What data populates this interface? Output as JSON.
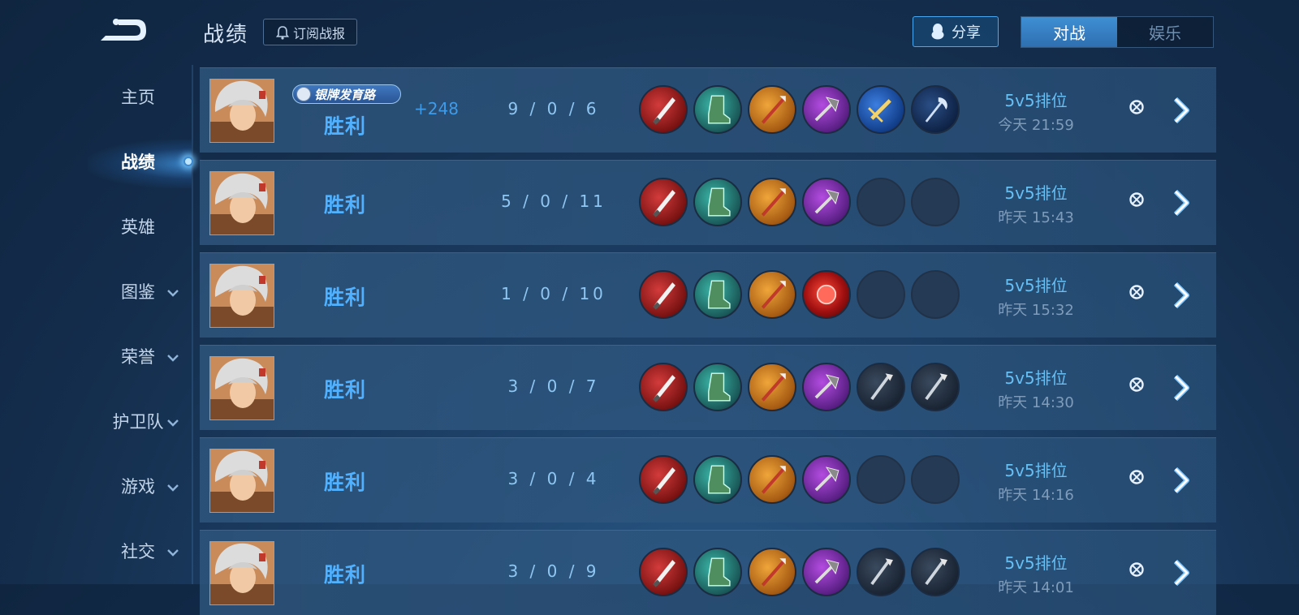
{
  "header": {
    "title": "战绩",
    "subscribe_label": "订阅战报",
    "share_label": "分享",
    "tabs": [
      {
        "label": "对战",
        "active": true
      },
      {
        "label": "娱乐",
        "active": false
      }
    ]
  },
  "sidebar": {
    "items": [
      {
        "label": "主页",
        "has_chevron": false,
        "active": false
      },
      {
        "label": "战绩",
        "has_chevron": false,
        "active": true
      },
      {
        "label": "英雄",
        "has_chevron": false,
        "active": false
      },
      {
        "label": "图鉴",
        "has_chevron": true,
        "active": false
      },
      {
        "label": "荣誉",
        "has_chevron": true,
        "active": false
      },
      {
        "label": "护卫队",
        "has_chevron": true,
        "active": false
      },
      {
        "label": "游戏",
        "has_chevron": true,
        "active": false
      },
      {
        "label": "社交",
        "has_chevron": true,
        "active": false
      }
    ]
  },
  "matches": [
    {
      "rank_badge": "银牌发育路",
      "score_change": "+248",
      "result": "胜利",
      "kda": "9 / 0 / 6",
      "mode": "5v5排位",
      "time": "今天 21:59",
      "items": [
        "red-blade-icon",
        "green-boots-icon",
        "orange-lance-icon",
        "purple-axe-icon",
        "blue-gold-sword-icon",
        "blue-scythe-icon"
      ]
    },
    {
      "rank_badge": "",
      "score_change": "",
      "result": "胜利",
      "kda": "5 / 0 / 11",
      "mode": "5v5排位",
      "time": "昨天 15:43",
      "items": [
        "red-blade-icon",
        "green-boots-icon",
        "orange-lance-icon",
        "purple-axe-icon",
        "empty",
        "empty"
      ]
    },
    {
      "rank_badge": "",
      "score_change": "",
      "result": "胜利",
      "kda": "1 / 0 / 10",
      "mode": "5v5排位",
      "time": "昨天 15:32",
      "items": [
        "red-blade-icon",
        "green-boots-icon",
        "orange-lance-icon",
        "red-orb-icon",
        "empty",
        "empty"
      ]
    },
    {
      "rank_badge": "",
      "score_change": "",
      "result": "胜利",
      "kda": "3 / 0 / 7",
      "mode": "5v5排位",
      "time": "昨天 14:30",
      "items": [
        "red-blade-icon",
        "green-boots-icon",
        "orange-lance-icon",
        "purple-axe-icon",
        "dark-spear-icon",
        "dark-spear-icon"
      ]
    },
    {
      "rank_badge": "",
      "score_change": "",
      "result": "胜利",
      "kda": "3 / 0 / 4",
      "mode": "5v5排位",
      "time": "昨天 14:16",
      "items": [
        "red-blade-icon",
        "green-boots-icon",
        "orange-lance-icon",
        "purple-axe-icon",
        "empty",
        "empty"
      ]
    },
    {
      "rank_badge": "",
      "score_change": "",
      "result": "胜利",
      "kda": "3 / 0 / 9",
      "mode": "5v5排位",
      "time": "昨天 14:01",
      "items": [
        "red-blade-icon",
        "green-boots-icon",
        "orange-lance-icon",
        "purple-axe-icon",
        "dark-spear-icon",
        "dark-spear-icon"
      ]
    }
  ],
  "colors": {
    "accent": "#4fb1ff",
    "active_tab": "#3a86cc",
    "background": "#173454"
  }
}
